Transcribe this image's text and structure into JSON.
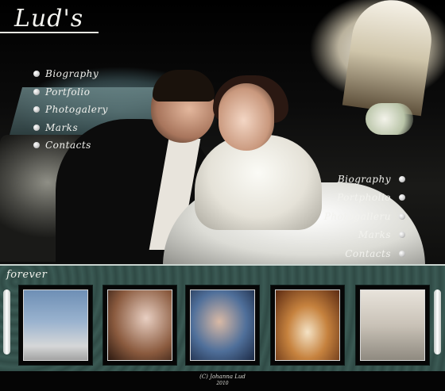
{
  "brand": {
    "logo": "Lud's"
  },
  "nav_left": {
    "items": [
      {
        "label": "Biography"
      },
      {
        "label": "Portfolio"
      },
      {
        "label": "Photogalery"
      },
      {
        "label": "Marks"
      },
      {
        "label": "Contacts"
      }
    ]
  },
  "nav_right": {
    "items": [
      {
        "label": "Biography"
      },
      {
        "label": "Portpholio"
      },
      {
        "label": "Photogalleru"
      },
      {
        "label": "Marks"
      },
      {
        "label": "Contacts"
      }
    ]
  },
  "gallery": {
    "title": "forever",
    "thumbnails": [
      {
        "id": "thumb-1"
      },
      {
        "id": "thumb-2"
      },
      {
        "id": "thumb-3"
      },
      {
        "id": "thumb-4"
      },
      {
        "id": "thumb-5"
      }
    ]
  },
  "footer": {
    "copyright": "(C) Johanna Lud",
    "year": "2010"
  },
  "colors": {
    "strip_teal": "#2f4a45",
    "menu_text": "#f2f2ee",
    "background": "#050505"
  }
}
